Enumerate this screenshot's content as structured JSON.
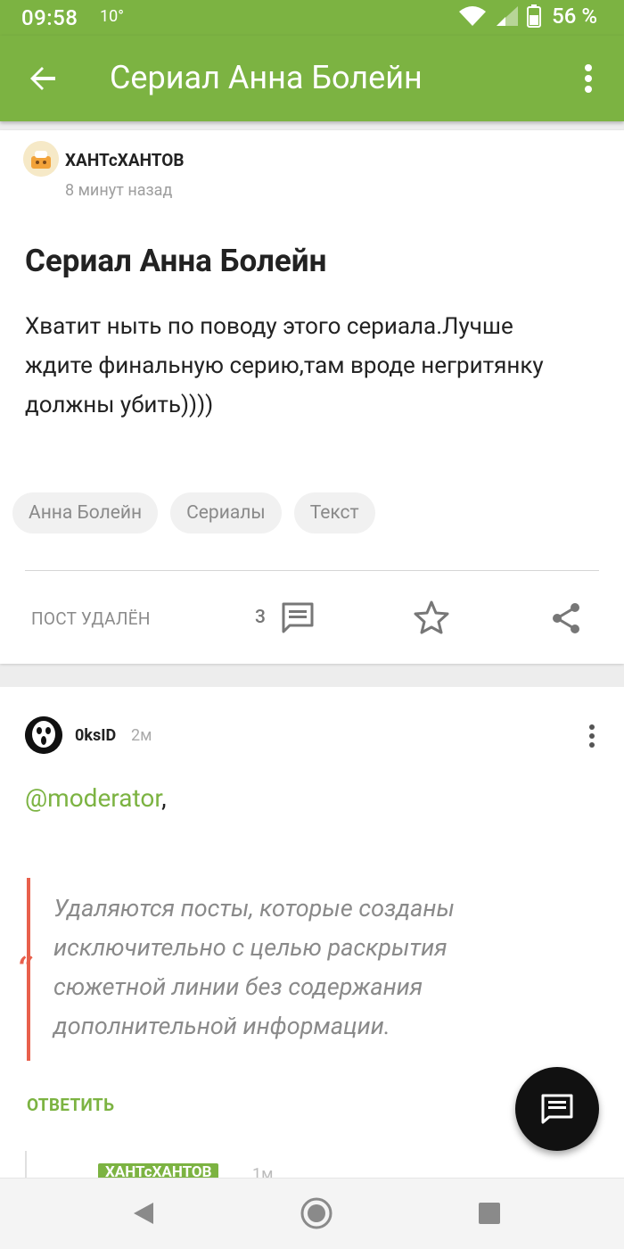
{
  "status_bar": {
    "time": "09:58",
    "temperature": "10°",
    "battery_percent": "56 %"
  },
  "app_bar": {
    "title": "Сериал Анна Болейн"
  },
  "post": {
    "author": "ХАНТсХАНТОВ",
    "time_ago": "8 минут назад",
    "title": "Сериал Анна Болейн",
    "body": "Хватит ныть по поводу этого сериала.Лучше ждите финальную серию,там вроде негритянку должны убить))))",
    "tags": [
      "Анна Болейн",
      "Сериалы",
      "Текст"
    ],
    "status": "ПОСТ УДАЛЁН",
    "comments_count": "3"
  },
  "comment": {
    "author": "0ksID",
    "time": "2м",
    "mention": "@moderator",
    "mention_suffix": ",",
    "quote": " Удаляются посты, которые созданы исключительно с целью раскрытия сюжетной линии без содержания дополнительной информации.",
    "reply_label": "ОТВЕТИТЬ"
  },
  "nested_comment": {
    "author": "ХАНТсХАНТОВ",
    "time": "1м"
  },
  "colors": {
    "accent": "#7cb342",
    "quote_accent": "#e8604c"
  }
}
